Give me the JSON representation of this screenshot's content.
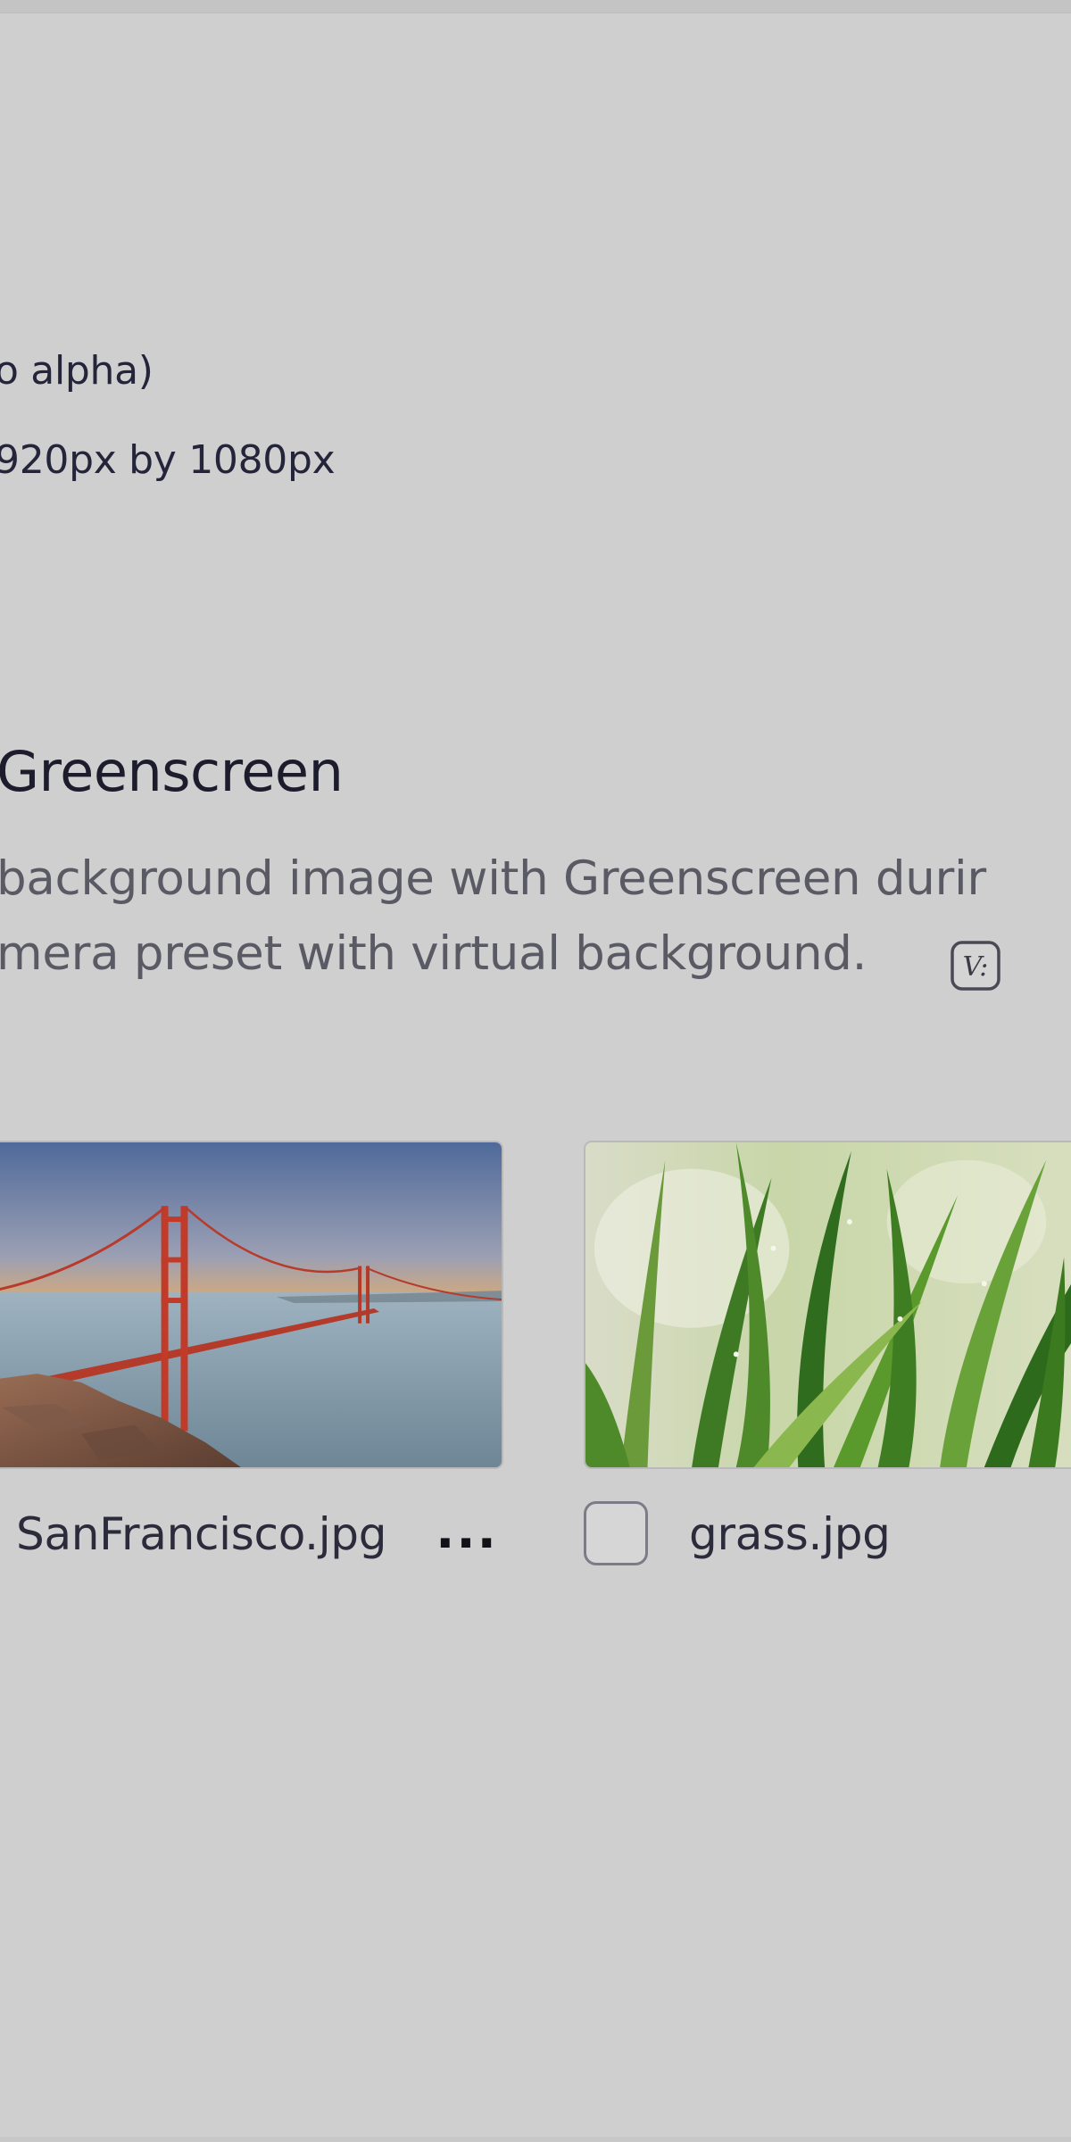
{
  "requirements": {
    "line1": "o alpha)",
    "line2": "920px by 1080px"
  },
  "section": {
    "title": "Greenscreen",
    "description_line1": "background image with Greenscreen durir",
    "description_line2": "mera preset with virtual background.",
    "info_icon": "virtual-background-icon"
  },
  "backgrounds": [
    {
      "filename": "SanFrancisco.jpg",
      "more_label": "...",
      "selected": false
    },
    {
      "filename": "grass.jpg",
      "selected": false
    }
  ],
  "colors": {
    "background": "#cfcfcf",
    "title_text": "#1c1c2c",
    "description_text": "#5a5a64"
  }
}
